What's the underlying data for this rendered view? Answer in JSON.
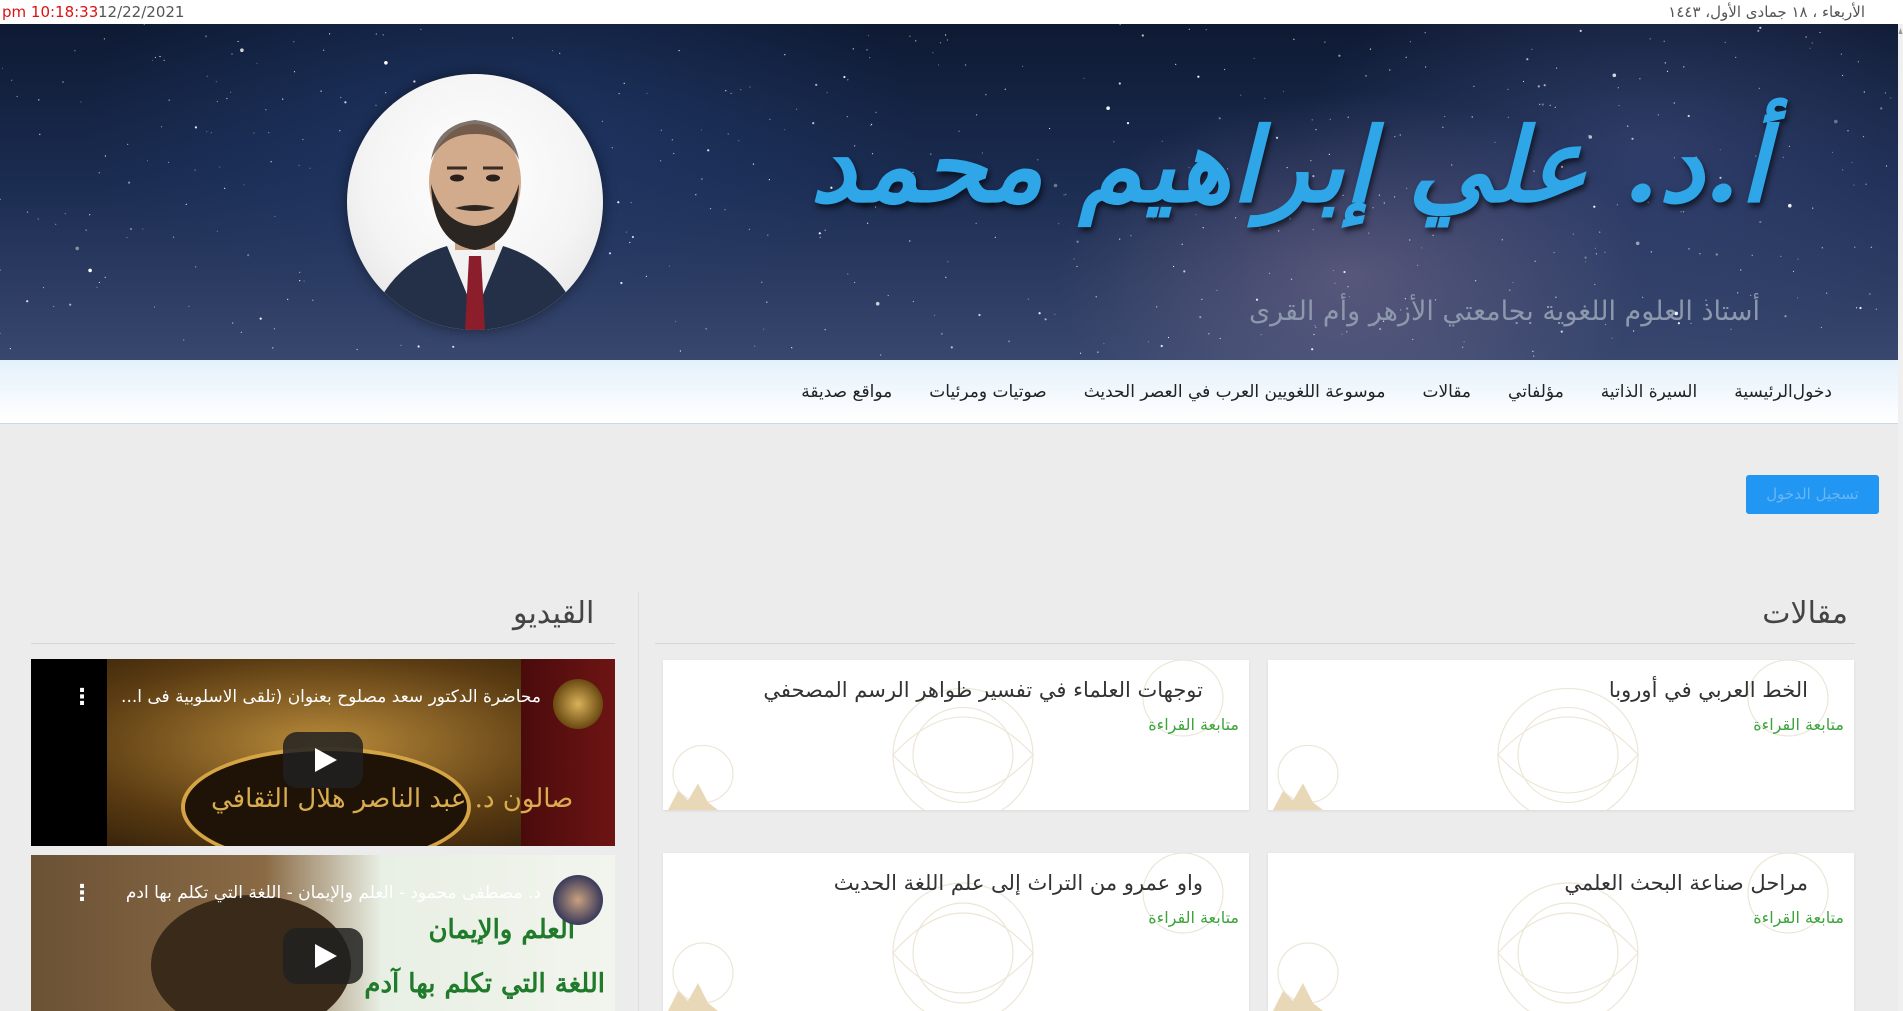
{
  "topbar": {
    "time": "pm 10:18:33",
    "gregorian_date": "12/22/2021",
    "hijri_date": "الأربعاء ، ١٨ جمادى الأول، ١٤٤٣"
  },
  "header": {
    "name": "أ.د. علي إبراهيم محمد",
    "subtitle": "أستاذ العلوم اللغوية بجامعتي الأزهر وأم القرى"
  },
  "nav": {
    "items": [
      "دخول",
      "الرئيسية",
      "السيرة الذاتية",
      "مؤلفاتي",
      "مقالات",
      "موسوعة اللغويين العرب في العصر الحديث",
      "صوتيات ومرئيات",
      "مواقع صديقة"
    ]
  },
  "login_button": {
    "label": "تسجيل الدخول"
  },
  "articles": {
    "title": "مقالات",
    "read_more": "متابعة القراءة",
    "items": [
      {
        "title": "الخط العربي في أوروبا"
      },
      {
        "title": "توجهات العلماء في تفسير ظواهر الرسم المصحفي"
      },
      {
        "title": "مراحل صناعة البحث العلمي"
      },
      {
        "title": "واو عمرو من التراث إلى علم اللغة الحديث"
      }
    ]
  },
  "videos": {
    "title": "القيديو",
    "items": [
      {
        "title": "محاضرة الدكتور سعد مصلوح بعنوان (تلقى الاسلوبية فى ا...",
        "overlay_text": "صالون د. عبد الناصر هلال الثقافي"
      },
      {
        "title": "د. مصطفى محمود - العلم والإيمان - اللغة التي تكلم بها ادم",
        "overlay_line1": "العلم والإيمان",
        "overlay_line2": "اللغة التي تكلم بها آدم"
      }
    ]
  },
  "colors": {
    "accent": "#2196f3",
    "title_blue": "#2fa6e8",
    "read_more_green": "#3ba53b",
    "time_red": "#dd1111"
  }
}
